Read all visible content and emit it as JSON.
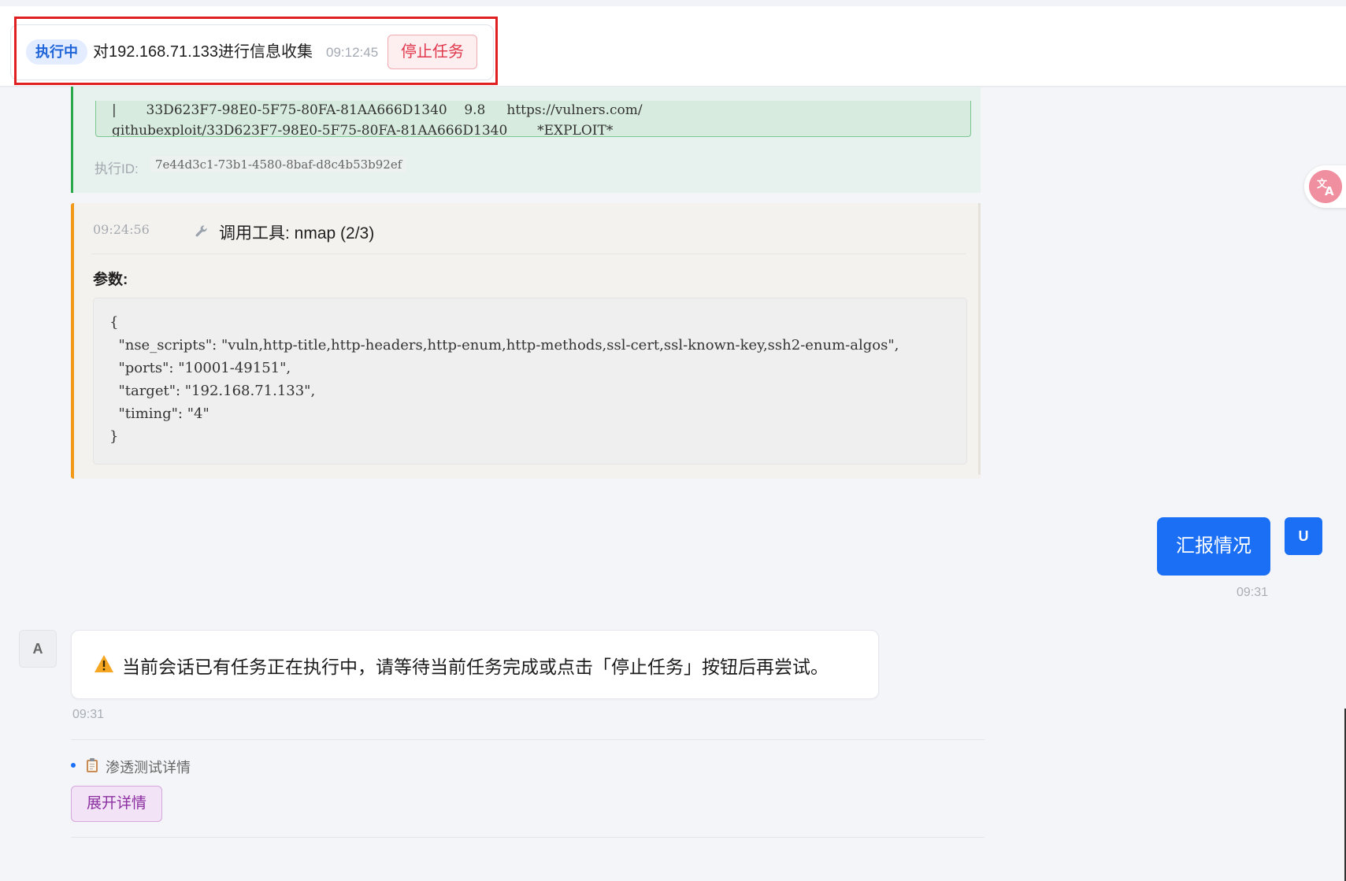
{
  "task_bar": {
    "status": "执行中",
    "title": "对192.168.71.133进行信息收集",
    "time": "09:12:45",
    "stop_label": "停止任务"
  },
  "result_block": {
    "lines": [
      "|       33D623F7-98E0-5F75-80FA-81AA666D1340    9.8     https://vulners.com/",
      "githubexploit/33D623F7-98E0-5F75-80FA-81AA666D1340       *EXPLOIT*"
    ],
    "exec_id_label": "执行ID:",
    "exec_id": "7e44d3c1-73b1-4580-8baf-d8c4b53b92ef"
  },
  "tool_call": {
    "time": "09:24:56",
    "icon": "wrench-icon",
    "title": "调用工具: nmap (2/3)",
    "params_label": "参数:",
    "code_lines": [
      "{",
      "  \"nse_scripts\": \"vuln,http-title,http-headers,http-enum,http-methods,ssl-cert,ssl-known-key,ssh2-enum-algos\",",
      "  \"ports\": \"10001-49151\",",
      "  \"target\": \"192.168.71.133\",",
      "  \"timing\": \"4\"",
      "}"
    ]
  },
  "user_message": {
    "avatar": "U",
    "text": "汇报情况",
    "time": "09:31"
  },
  "assistant_message": {
    "avatar": "A",
    "icon": "warning-icon",
    "text": "当前会话已有任务正在执行中，请等待当前任务完成或点击「停止任务」按钮后再尝试。",
    "time": "09:31"
  },
  "details": {
    "icon": "clipboard-icon",
    "label": "渗透测试详情",
    "expand_label": "展开详情"
  },
  "colors": {
    "accent": "#1a6ff5",
    "running": "#1f63d9",
    "stop": "#e0384c",
    "success_border": "#2aa84a",
    "tool_border": "#f29a17",
    "expand": "#8b2fa1"
  }
}
